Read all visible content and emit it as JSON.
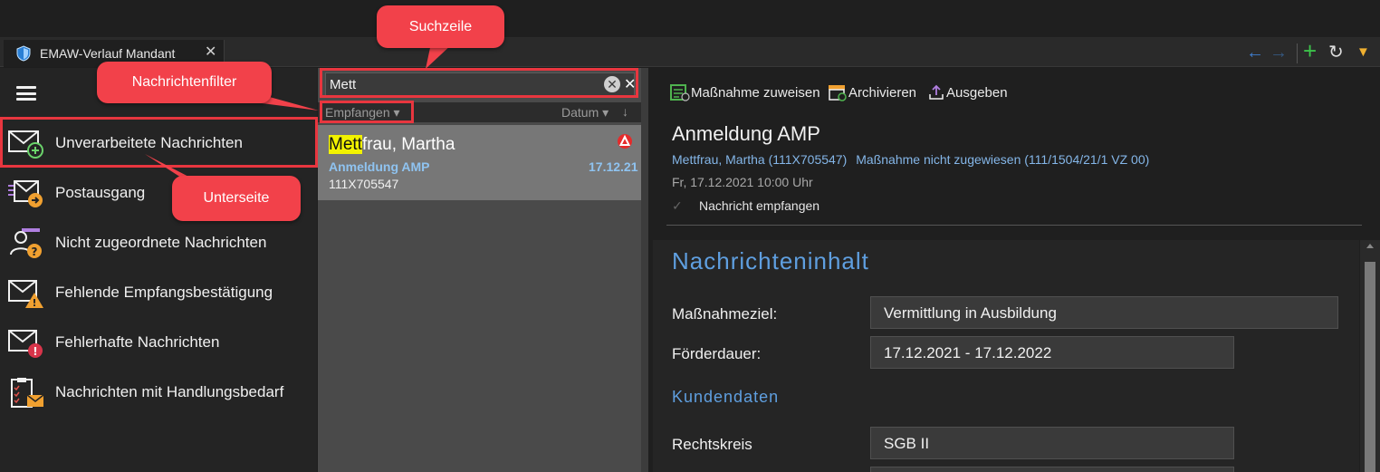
{
  "tab": {
    "title": "EMAW-Verlauf Mandant",
    "close": "✕"
  },
  "toolbar_right": {
    "back": "←",
    "forward": "→",
    "add": "+",
    "refresh": "↻",
    "menu": "▼"
  },
  "sidebar": {
    "items": [
      {
        "label": "Unverarbeitete Nachrichten",
        "icon": "envelope-plus-icon"
      },
      {
        "label": "Postausgang",
        "icon": "outbox-icon"
      },
      {
        "label": "Nicht zugeordnete Nachrichten",
        "icon": "unassigned-user-icon"
      },
      {
        "label": "Fehlende Empfangsbestätigung",
        "icon": "envelope-warning-icon"
      },
      {
        "label": "Fehlerhafte Nachrichten",
        "icon": "envelope-error-icon"
      },
      {
        "label": "Nachrichten mit Handlungsbedarf",
        "icon": "clipboard-envelope-icon"
      }
    ]
  },
  "list": {
    "search_value": "Mett",
    "clear": "✕",
    "close": "✕",
    "filter_label": "Empfangen ▾",
    "sort_label": "Datum ▾",
    "sort_arrow": "↓",
    "message": {
      "name_highlight": "Mett",
      "name_rest": "frau, Martha",
      "subject": "Anmeldung AMP",
      "date": "17.12.21",
      "id": "111X705547"
    }
  },
  "detail": {
    "actions": {
      "assign": "Maßnahme zuweisen",
      "archive": "Archivieren",
      "output": "Ausgeben"
    },
    "title": "Anmeldung AMP",
    "person": "Mettfrau, Martha (111X705547)",
    "measure": "Maßnahme nicht zugewiesen (111/1504/21/1 VZ 00)",
    "datetime": "Fr, 17.12.2021 10:00 Uhr",
    "status": "Nachricht empfangen",
    "content": {
      "section_title": "Nachrichteninhalt",
      "fields": [
        {
          "label": "Maßnahmeziel:",
          "value": "Vermittlung in Ausbildung"
        },
        {
          "label": "Förderdauer:",
          "value": "17.12.2021 - 17.12.2022"
        }
      ],
      "subsection_title": "Kundendaten",
      "customer_fields": [
        {
          "label": "Rechtskreis",
          "value": "SGB II"
        }
      ]
    }
  },
  "callouts": {
    "search": "Suchzeile",
    "filter": "Nachrichtenfilter",
    "subpage": "Unterseite"
  },
  "colors": {
    "accent_blue": "#5f9fe0",
    "link_blue": "#84b6e8",
    "callout_red": "#f2414a",
    "highlight_yellow": "#f2f200"
  }
}
